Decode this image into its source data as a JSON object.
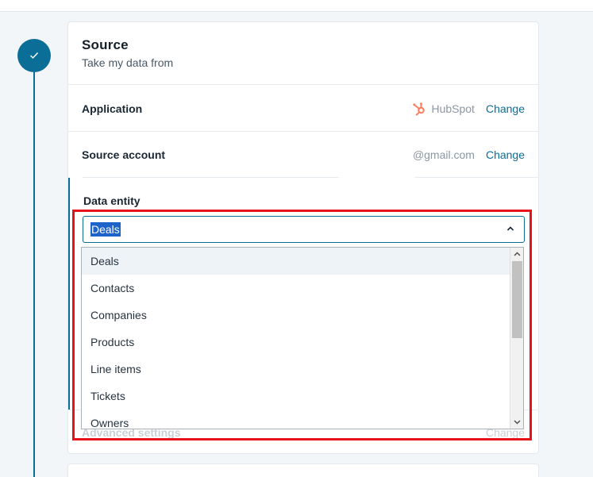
{
  "source": {
    "title": "Source",
    "subtitle": "Take my data from"
  },
  "application": {
    "label": "Application",
    "value": "HubSpot",
    "icon": "hubspot-icon",
    "change_label": "Change"
  },
  "source_account": {
    "label": "Source account",
    "value": "@gmail.com",
    "change_label": "Change"
  },
  "data_entity": {
    "label": "Data entity",
    "selected": "Deals",
    "options": [
      "Deals",
      "Contacts",
      "Companies",
      "Products",
      "Line items",
      "Tickets",
      "Owners"
    ]
  },
  "advanced_settings": {
    "label": "Advanced settings",
    "change_label": "Change"
  },
  "colors": {
    "accent": "#0b6e97",
    "highlight": "#e8121b",
    "hubspot": "#ff7a59",
    "selection": "#1e63c9"
  }
}
